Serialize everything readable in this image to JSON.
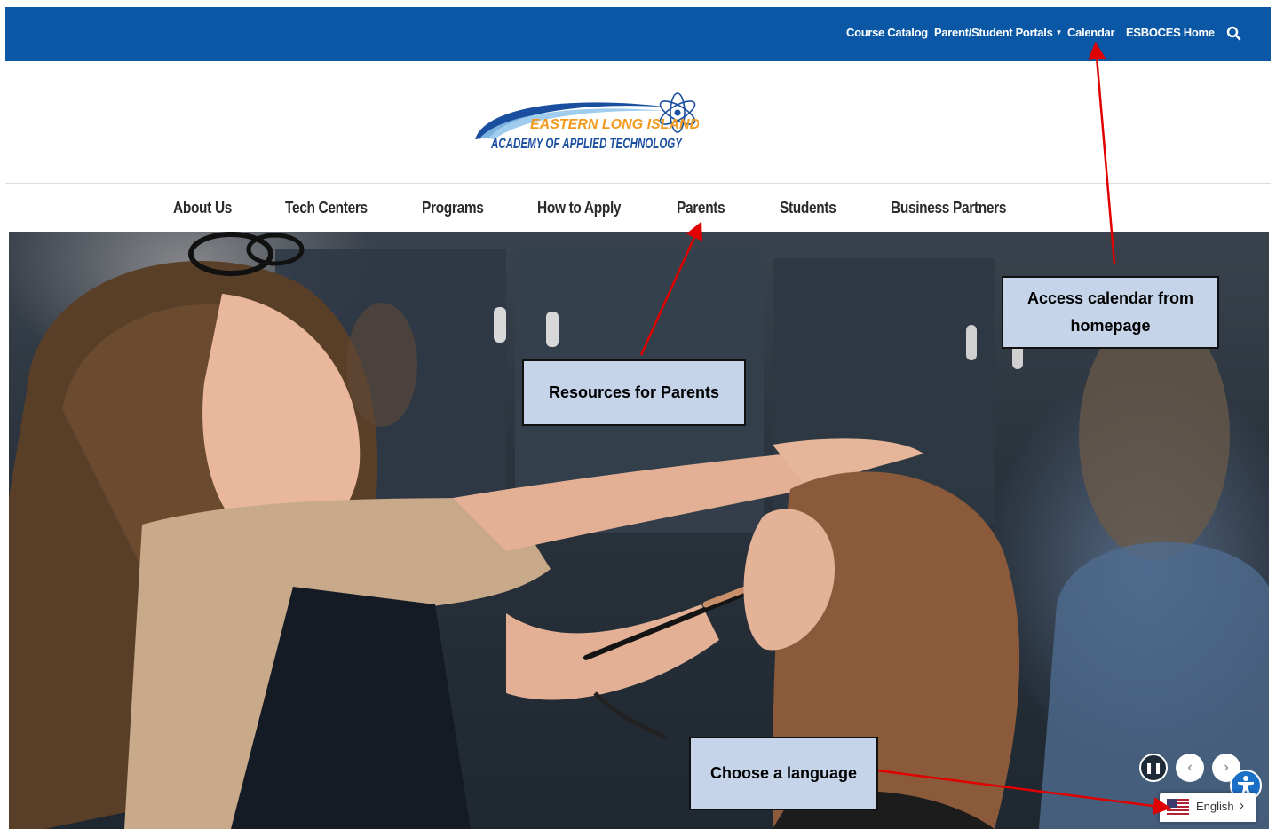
{
  "utility_nav": {
    "course_catalog": "Course Catalog",
    "portals": "Parent/Student Portals",
    "calendar": "Calendar",
    "esboces_home": "ESBOCES Home"
  },
  "logo": {
    "line1": "EASTERN LONG ISLAND",
    "line2": "ACADEMY OF APPLIED TECHNOLOGY"
  },
  "main_nav": [
    "About Us",
    "Tech Centers",
    "Programs",
    "How to Apply",
    "Parents",
    "Students",
    "Business Partners"
  ],
  "language": {
    "selected": "English"
  },
  "annotations": {
    "calendar_note": "Access calendar from homepage",
    "parents_note": "Resources for Parents",
    "language_note": "Choose a language"
  },
  "colors": {
    "topbar": "#0a58a5",
    "callout_fill": "#c5d4e9",
    "arrow": "#e00000",
    "logo_orange": "#f39a1e",
    "logo_blue": "#1a4fa0"
  },
  "icons": {
    "search": "search-icon",
    "pause": "pause-icon",
    "prev": "chevron-left-icon",
    "next": "chevron-right-icon",
    "accessibility": "accessibility-icon",
    "flag": "us-flag-icon"
  }
}
